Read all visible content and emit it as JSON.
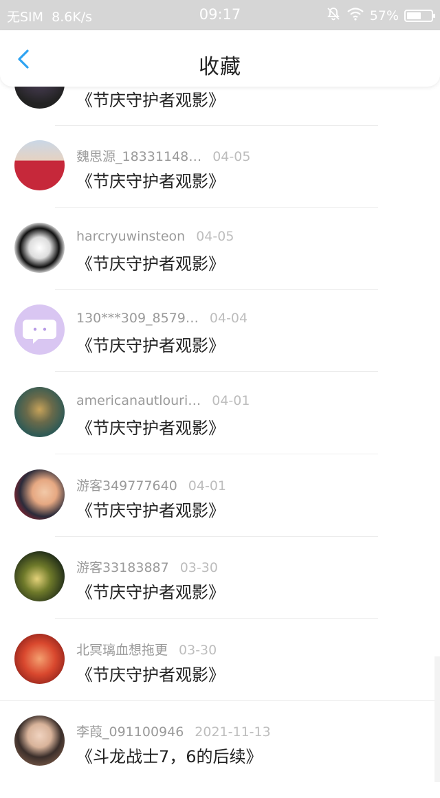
{
  "status_bar": {
    "carrier": "无SIM",
    "speed": "8.6K/s",
    "time": "09:17",
    "battery": "57%"
  },
  "header": {
    "title": "收藏"
  },
  "items": [
    {
      "user": "",
      "date": "",
      "title": "《节庆守护者观影》"
    },
    {
      "user": "魏思源_18331148…",
      "date": "04-05",
      "title": "《节庆守护者观影》"
    },
    {
      "user": "harcryuwinsteon",
      "date": "04-05",
      "title": "《节庆守护者观影》"
    },
    {
      "user": "130***309_8579…",
      "date": "04-04",
      "title": "《节庆守护者观影》"
    },
    {
      "user": "americanautlouri…",
      "date": "04-01",
      "title": "《节庆守护者观影》"
    },
    {
      "user": "游客349777640",
      "date": "04-01",
      "title": "《节庆守护者观影》"
    },
    {
      "user": "游客33183887",
      "date": "03-30",
      "title": "《节庆守护者观影》"
    },
    {
      "user": "北冥璃血想拖更",
      "date": "03-30",
      "title": "《节庆守护者观影》"
    },
    {
      "user": "李葭_091100946",
      "date": "2021-11-13",
      "title": "《斗龙战士7，6的后续》"
    }
  ],
  "colors": {
    "accent": "#2ea3f2",
    "status_bar_bg": "#d6d6d6",
    "meta_text": "#9a9a9a",
    "date_text": "#bdbdbd"
  }
}
